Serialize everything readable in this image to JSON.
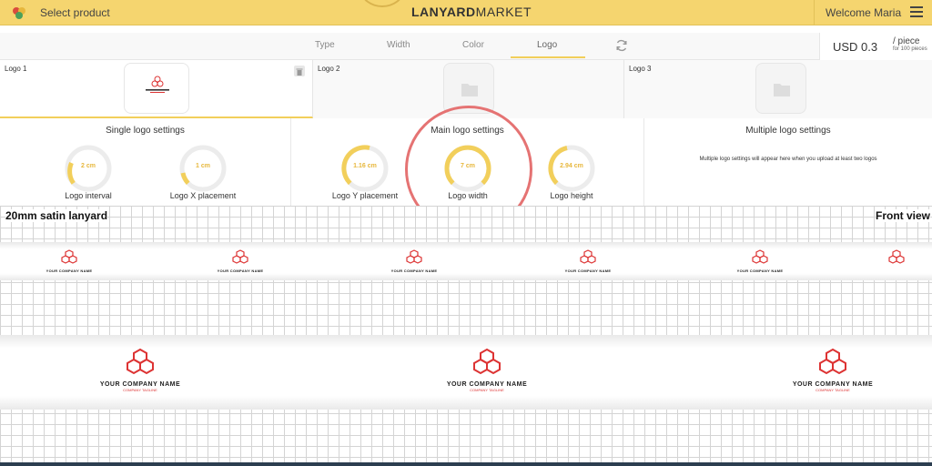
{
  "header": {
    "select_product": "Select product",
    "brand_bold": "LANYARD",
    "brand_light": "MARKET",
    "welcome": "Welcome Maria",
    "menu_icon": "hamburger-menu-icon"
  },
  "tabs": [
    {
      "label": "Type"
    },
    {
      "label": "Width"
    },
    {
      "label": "Color"
    },
    {
      "label": "Logo",
      "active": true
    }
  ],
  "price": {
    "amount": "USD 0.3",
    "per": "/ piece",
    "note": "for 100 pieces"
  },
  "logos": [
    {
      "label": "Logo 1",
      "state": "uploaded"
    },
    {
      "label": "Logo 2",
      "state": "empty"
    },
    {
      "label": "Logo 3",
      "state": "empty"
    }
  ],
  "settings": {
    "single": {
      "title": "Single logo settings",
      "dials": [
        {
          "caption": "Logo interval",
          "value": "2 cm"
        },
        {
          "caption": "Logo X placement",
          "value": "1 cm"
        }
      ]
    },
    "main": {
      "title": "Main logo settings",
      "dials": [
        {
          "caption": "Logo Y placement",
          "value": "1.16 cm"
        },
        {
          "caption": "Logo width",
          "value": "7 cm"
        },
        {
          "caption": "Logo height",
          "value": "2.94 cm"
        }
      ]
    },
    "multiple": {
      "title": "Multiple logo settings",
      "note": "Multiple logo settings will appear here when you upload at least two logos"
    }
  },
  "preview": {
    "title": "20mm satin lanyard",
    "view": "Front view",
    "company_name": "YOUR COMPANY NAME",
    "tagline": "COMPANY TAGLINE"
  },
  "colors": {
    "accent": "#f2cf5b",
    "topbar": "#f5d56f",
    "logo_red": "#d33333",
    "highlight": "#e57373"
  }
}
